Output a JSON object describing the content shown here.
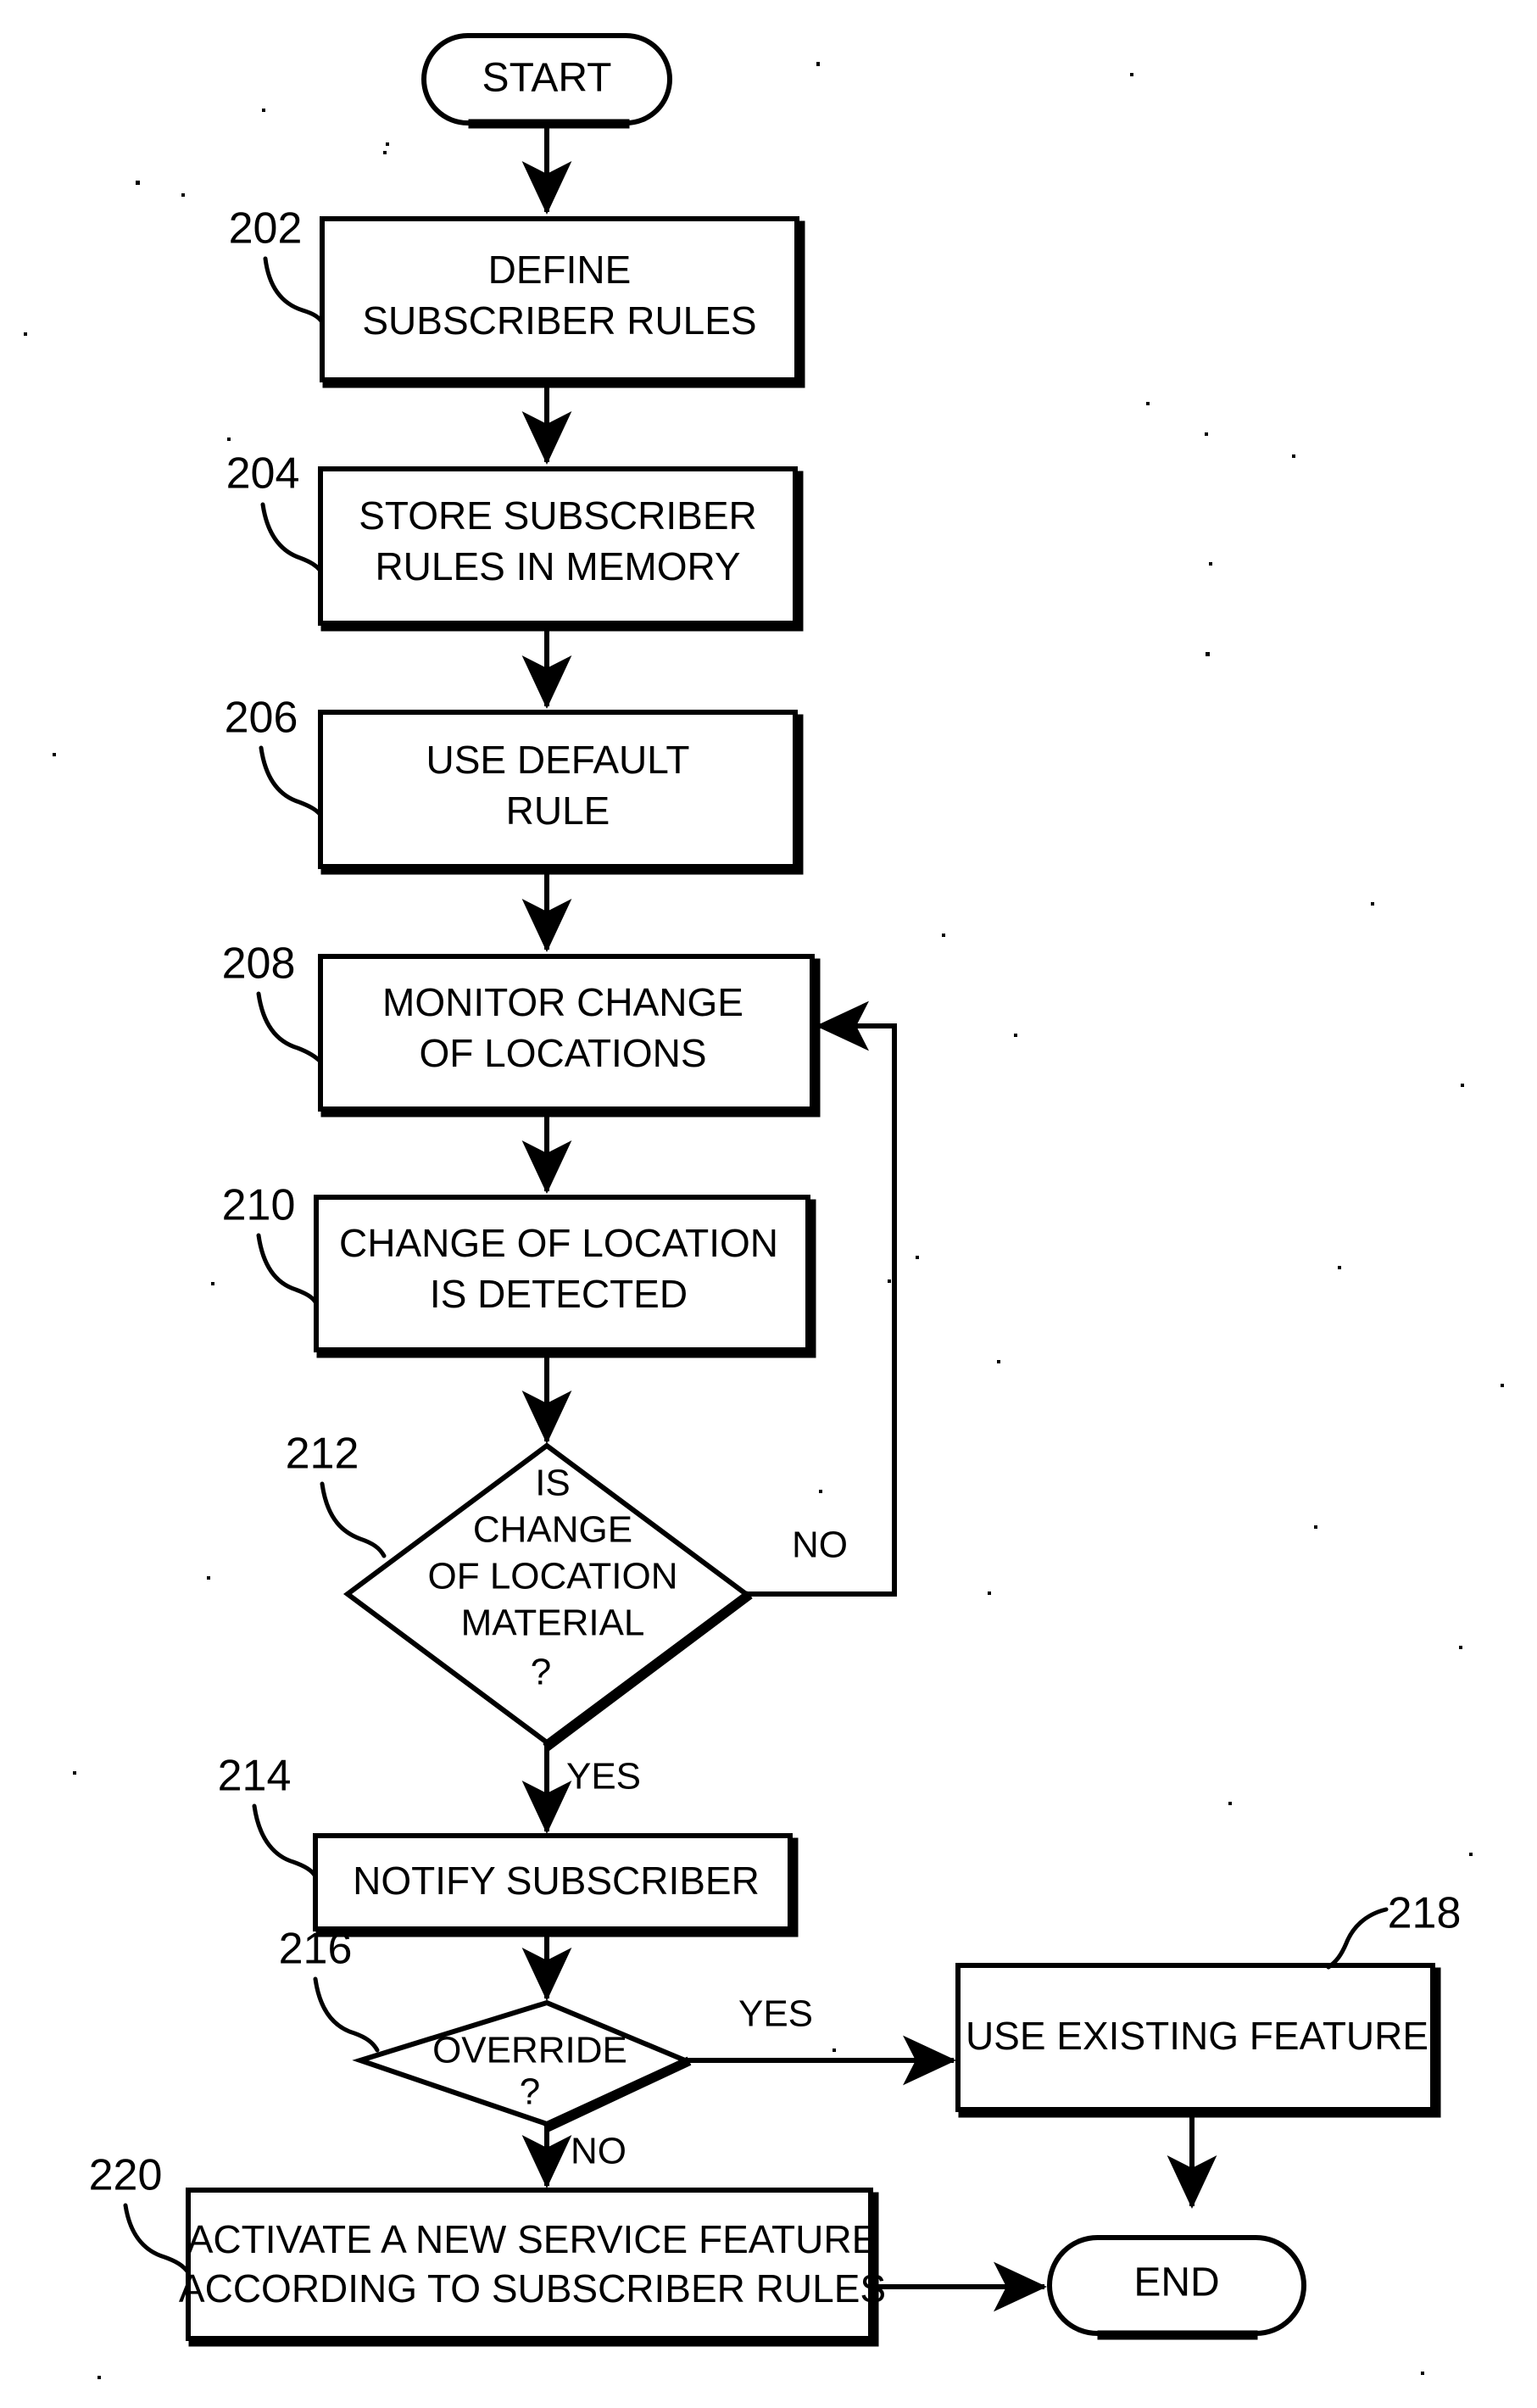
{
  "figure": {
    "type": "patent-flowchart",
    "background_color": "#ffffff",
    "ink_color": "#000000"
  },
  "nodes": {
    "start": {
      "label": "START",
      "shape": "terminator"
    },
    "n202": {
      "ref": "202",
      "shape": "process",
      "lines": [
        "DEFINE",
        "SUBSCRIBER RULES"
      ]
    },
    "n204": {
      "ref": "204",
      "shape": "process",
      "lines": [
        "STORE SUBSCRIBER",
        "RULES  IN MEMORY"
      ]
    },
    "n206": {
      "ref": "206",
      "shape": "process",
      "lines": [
        "USE DEFAULT",
        "RULE"
      ]
    },
    "n208": {
      "ref": "208",
      "shape": "process",
      "lines": [
        "MONITOR CHANGE",
        "OF LOCATIONS"
      ]
    },
    "n210": {
      "ref": "210",
      "shape": "process",
      "lines": [
        "CHANGE OF LOCATION",
        "IS DETECTED"
      ]
    },
    "n212": {
      "ref": "212",
      "shape": "decision",
      "lines": [
        "IS",
        "CHANGE",
        "OF LOCATION",
        "MATERIAL",
        "?"
      ]
    },
    "n214": {
      "ref": "214",
      "shape": "process",
      "lines": [
        "NOTIFY SUBSCRIBER"
      ]
    },
    "n216": {
      "ref": "216",
      "shape": "decision",
      "lines": [
        "OVERRIDE",
        "?"
      ]
    },
    "n218": {
      "ref": "218",
      "shape": "process",
      "lines": [
        "USE EXISTING FEATURE"
      ]
    },
    "n220": {
      "ref": "220",
      "shape": "process",
      "lines": [
        "ACTIVATE A NEW SERVICE FEATURE",
        "ACCORDING TO SUBSCRIBER RULES"
      ]
    },
    "end": {
      "label": "END",
      "shape": "terminator"
    }
  },
  "edge_labels": {
    "no_212": "NO",
    "yes_212": "YES",
    "yes_216": "YES",
    "no_216": "NO"
  },
  "edges": [
    {
      "from": "start",
      "to": "n202",
      "label": ""
    },
    {
      "from": "n202",
      "to": "n204",
      "label": ""
    },
    {
      "from": "n204",
      "to": "n206",
      "label": ""
    },
    {
      "from": "n206",
      "to": "n208",
      "label": ""
    },
    {
      "from": "n208",
      "to": "n210",
      "label": ""
    },
    {
      "from": "n210",
      "to": "n212",
      "label": ""
    },
    {
      "from": "n212",
      "to": "n208",
      "label": "NO"
    },
    {
      "from": "n212",
      "to": "n214",
      "label": "YES"
    },
    {
      "from": "n214",
      "to": "n216",
      "label": ""
    },
    {
      "from": "n216",
      "to": "n218",
      "label": "YES"
    },
    {
      "from": "n216",
      "to": "n220",
      "label": "NO"
    },
    {
      "from": "n218",
      "to": "end",
      "label": ""
    },
    {
      "from": "n220",
      "to": "end",
      "label": ""
    }
  ]
}
